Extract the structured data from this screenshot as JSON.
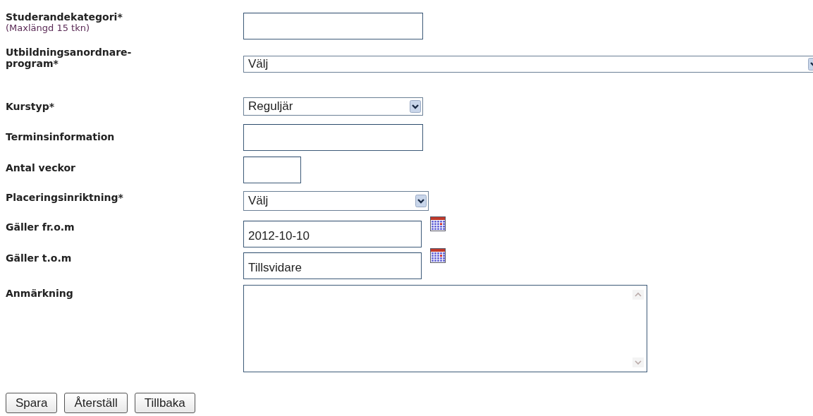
{
  "fields": [
    {
      "label": "Studerandekategori*",
      "hint": "(Maxlängd 15 tkn)",
      "kind": "text"
    },
    {
      "label": "Utbildningsanordnare-program*",
      "kind": "select",
      "value": "Välj"
    },
    {
      "label": "Kurstyp*",
      "kind": "select",
      "value": "Reguljär"
    },
    {
      "label": "Terminsinformation",
      "kind": "text"
    },
    {
      "label": "Antal veckor",
      "kind": "text"
    },
    {
      "label": "Placeringsinriktning*",
      "kind": "select",
      "value": "Välj"
    },
    {
      "label": "Gäller fr.o.m",
      "kind": "date",
      "value": "2012-10-10"
    },
    {
      "label": "Gäller t.o.m",
      "kind": "date",
      "value": "Tillsvidare"
    },
    {
      "label": "Anmärkning",
      "kind": "textarea"
    }
  ],
  "buttons": [
    "Spara",
    "Återställ",
    "Tillbaka"
  ]
}
